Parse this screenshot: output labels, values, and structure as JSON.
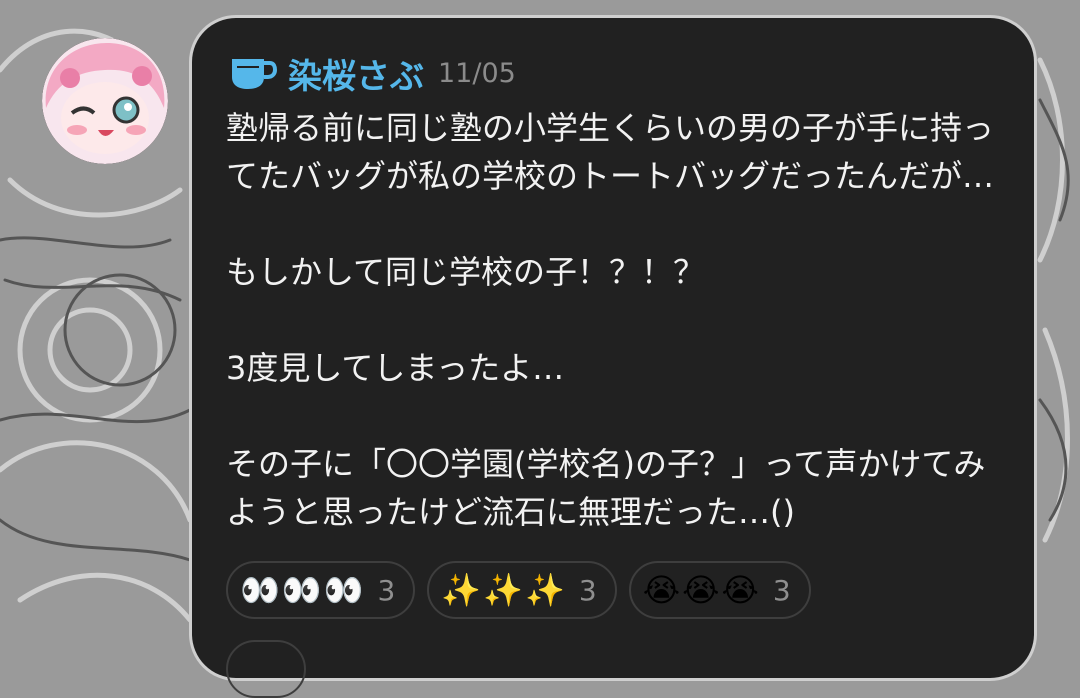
{
  "post": {
    "username": "染桜さぶ",
    "date": "11/05",
    "message": "塾帰る前に同じ塾の小学生くらいの男の子が手に持ってたバッグが私の学校のトートバッグだったんだが…\n\nもしかして同じ学校の子！？！？\n\n3度見してしまったよ…\n\nその子に「〇〇学園(学校名)の子？」って声かけてみようと思ったけど流石に無理だった…()"
  },
  "reactions": [
    {
      "emoji": "👀👀👀",
      "count": "3"
    },
    {
      "emoji": "✨✨✨",
      "count": "3"
    },
    {
      "emoji": "😭😭😭",
      "count": "3"
    }
  ],
  "colors": {
    "card": "#212121",
    "username": "#55b7ea",
    "text": "#f2f2f2",
    "muted": "#8b8b8b"
  },
  "icons": [
    "coffee-cup-icon",
    "avatar"
  ]
}
